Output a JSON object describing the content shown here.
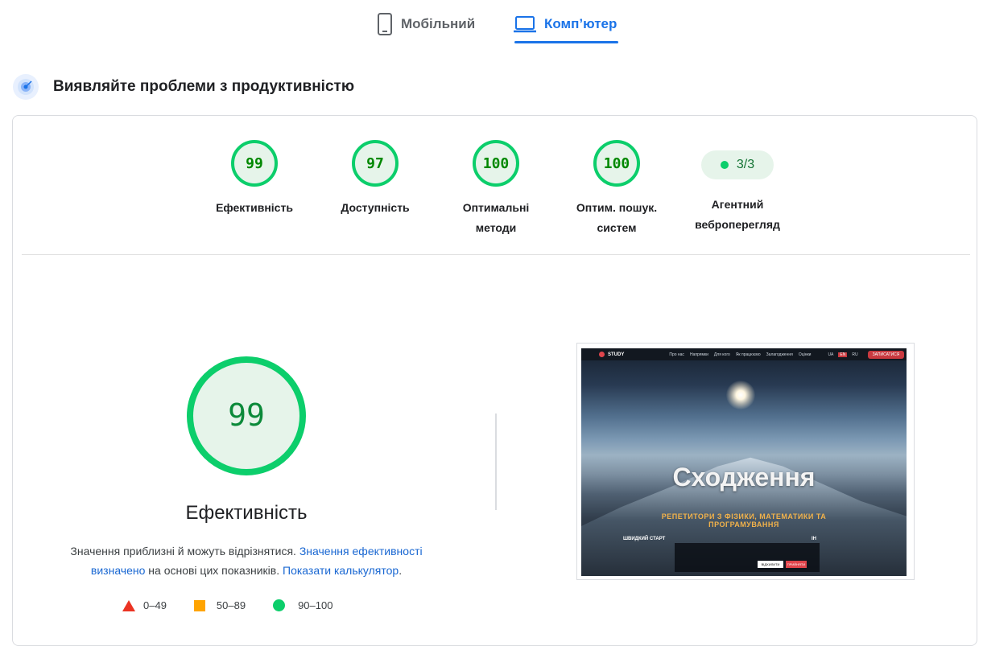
{
  "tabs": {
    "mobile_label": "Мобільний",
    "desktop_label": "Комп’ютер",
    "active": "desktop"
  },
  "section": {
    "title": "Виявляйте проблеми з продуктивністю"
  },
  "categories": [
    {
      "score": "99",
      "label": "Ефективність"
    },
    {
      "score": "97",
      "label": "Доступність"
    },
    {
      "score": "100",
      "label_line1": "Оптимальні",
      "label_line2": "методи"
    },
    {
      "score": "100",
      "label_line1": "Оптим. пошук.",
      "label_line2": "систем"
    },
    {
      "badge": "3/3",
      "label_line1": "Агентний",
      "label_line2": "веброперегляд"
    }
  ],
  "performance": {
    "score": "99",
    "title": "Ефективність",
    "note_prefix": "Значення приблизні й можуть відрізнятися.",
    "note_link1": "Значення ефективності визначено",
    "note_middle": "на основі цих показників.",
    "note_link2": "Показати калькулятор",
    "note_end": "."
  },
  "legend": [
    {
      "range": "0–49",
      "color": "#eb3323",
      "shape": "triangle"
    },
    {
      "range": "50–89",
      "color": "#ffa400",
      "shape": "square"
    },
    {
      "range": "90–100",
      "color": "#0cce6b",
      "shape": "circle"
    }
  ],
  "screenshot": {
    "logo": "STUDY",
    "nav": [
      "Про нас",
      "Напрямки",
      "Для кого",
      "Як працюємо",
      "Залагодження",
      "Оцінки"
    ],
    "langs": [
      "UA",
      "EN",
      "RU"
    ],
    "cta": "ЗАПИСАТИСЯ",
    "hero": "Сходження",
    "subtitle": "РЕПЕТИТОРИ З ФІЗИКИ, МАТЕМАТИКИ ТА ПРОГРАМУВАННЯ",
    "quick_start": "ШВИДКИЙ СТАРТ",
    "quick_right": "ІН",
    "btn_accept": "ВІДХИЛИТИ",
    "btn_reject": "ПРИЙНЯТИ"
  },
  "colors": {
    "accent": "#1a73e8",
    "pass_green": "#0cce6b",
    "pass_green_text": "#008800",
    "pass_green_bg": "#e6f4ea"
  },
  "icons": {
    "mobile": "phone-icon",
    "desktop": "laptop-icon",
    "section": "radar-icon"
  }
}
